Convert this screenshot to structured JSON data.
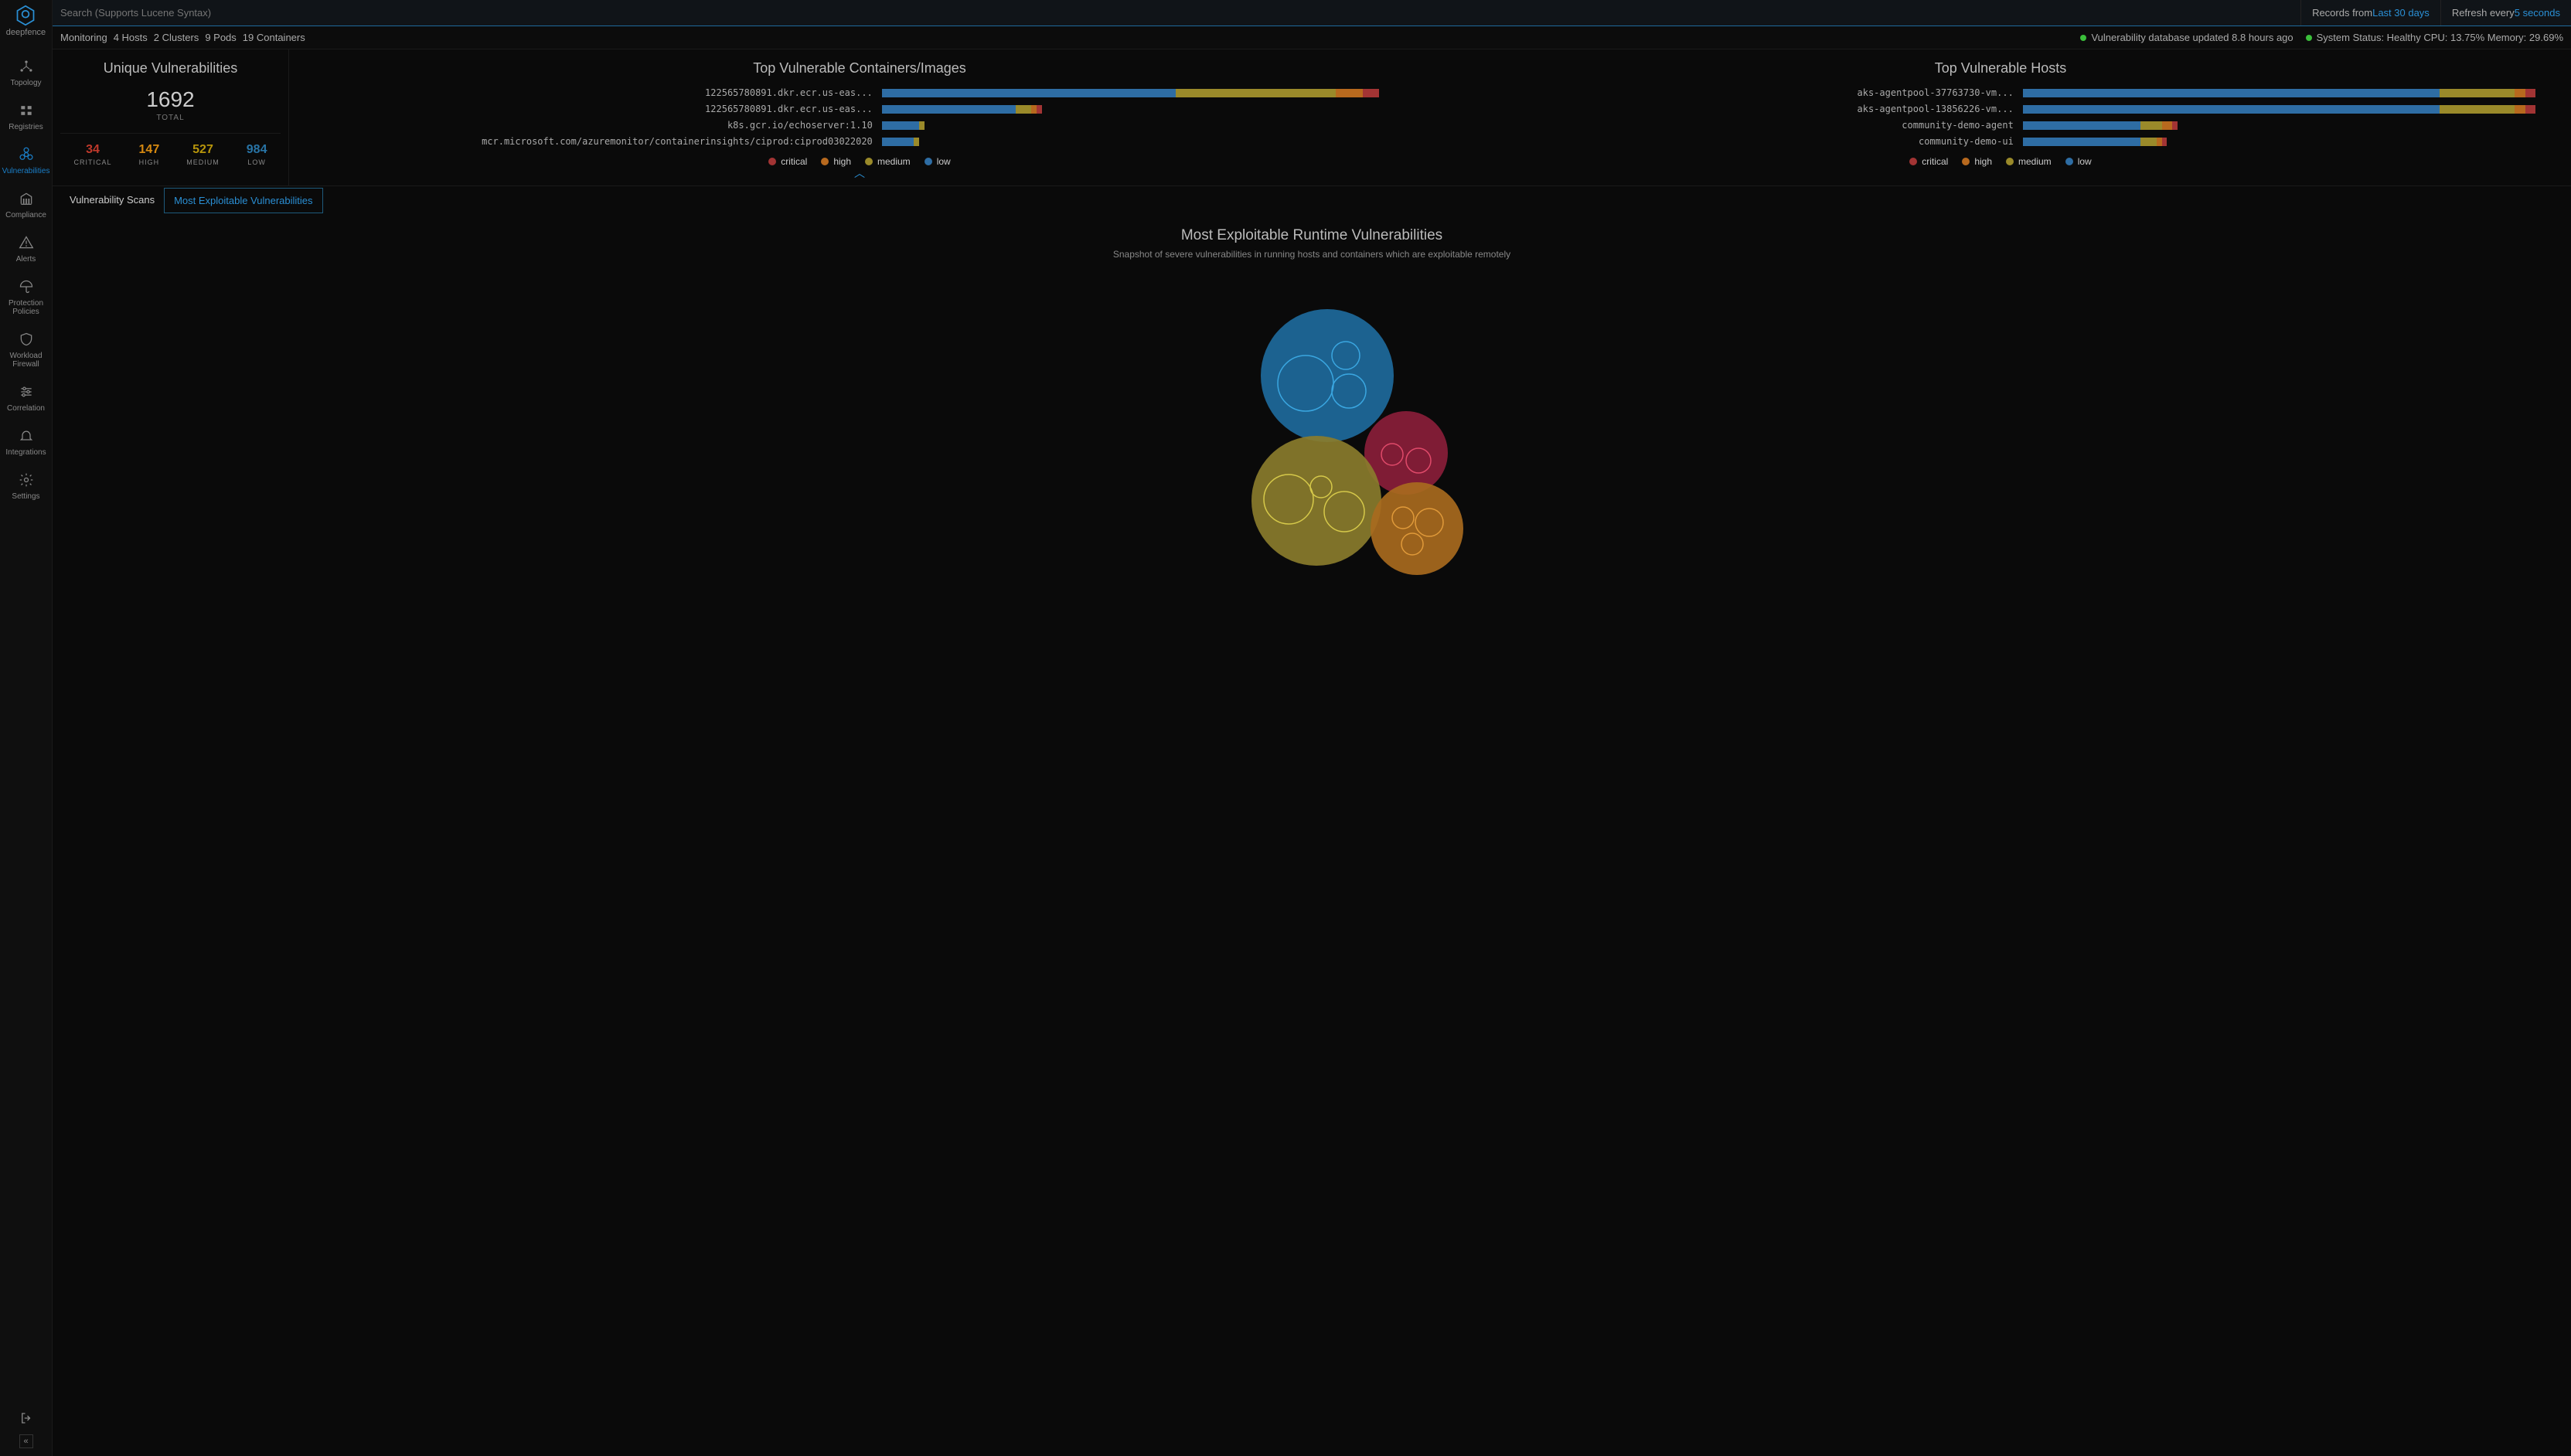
{
  "brand": "deepfence",
  "search": {
    "placeholder": "Search (Supports Lucene Syntax)"
  },
  "topbar": {
    "records_label": "Records from ",
    "records_value": "Last 30 days",
    "refresh_label": "Refresh every ",
    "refresh_value": "5 seconds"
  },
  "statusbar": {
    "monitoring": "Monitoring",
    "hosts": "4 Hosts",
    "clusters": "2 Clusters",
    "pods": "9 Pods",
    "containers": "19 Containers",
    "vuln_db": "Vulnerability database updated 8.8 hours ago",
    "system_status": "System Status: Healthy CPU: 13.75% Memory: 29.69%"
  },
  "sidebar": {
    "items": [
      {
        "label": "Topology"
      },
      {
        "label": "Registries"
      },
      {
        "label": "Vulnerabilities"
      },
      {
        "label": "Compliance"
      },
      {
        "label": "Alerts"
      },
      {
        "label": "Protection Policies"
      },
      {
        "label": "Workload Firewall"
      },
      {
        "label": "Correlation"
      },
      {
        "label": "Integrations"
      },
      {
        "label": "Settings"
      }
    ]
  },
  "unique": {
    "title": "Unique Vulnerabilities",
    "total": "1692",
    "total_label": "TOTAL",
    "severities": [
      {
        "value": "34",
        "label": "CRITICAL",
        "class": "critical"
      },
      {
        "value": "147",
        "label": "HIGH",
        "class": "high"
      },
      {
        "value": "527",
        "label": "MEDIUM",
        "class": "medium"
      },
      {
        "value": "984",
        "label": "LOW",
        "class": "low"
      }
    ]
  },
  "legend": {
    "critical": "critical",
    "high": "high",
    "medium": "medium",
    "low": "low"
  },
  "tabs": {
    "scans": "Vulnerability Scans",
    "exploit": "Most Exploitable Vulnerabilities"
  },
  "section": {
    "title": "Most Exploitable Runtime Vulnerabilities",
    "subtitle": "Snapshot of severe vulnerabilities in running hosts and containers which are exploitable remotely"
  },
  "chart_data": [
    {
      "type": "bar",
      "title": "Top Vulnerable Containers/Images",
      "orientation": "horizontal",
      "stacked": true,
      "xlabel": "",
      "ylabel": "",
      "categories": [
        "122565780891.dkr.ecr.us-eas...",
        "122565780891.dkr.ecr.us-eas...",
        "k8s.gcr.io/echoserver:1.10",
        "mcr.microsoft.com/azuremonitor/containerinsights/ciprod:ciprod03022020"
      ],
      "series": [
        {
          "name": "low",
          "values": [
            55,
            25,
            7,
            6
          ]
        },
        {
          "name": "medium",
          "values": [
            30,
            3,
            1,
            1
          ]
        },
        {
          "name": "high",
          "values": [
            5,
            1,
            0,
            0
          ]
        },
        {
          "name": "critical",
          "values": [
            3,
            1,
            0,
            0
          ]
        }
      ],
      "xlim": [
        0,
        100
      ]
    },
    {
      "type": "bar",
      "title": "Top Vulnerable Hosts",
      "orientation": "horizontal",
      "stacked": true,
      "xlabel": "",
      "ylabel": "",
      "categories": [
        "aks-agentpool-37763730-vm...",
        "aks-agentpool-13856226-vm...",
        "community-demo-agent",
        "community-demo-ui"
      ],
      "series": [
        {
          "name": "low",
          "values": [
            78,
            78,
            22,
            22
          ]
        },
        {
          "name": "medium",
          "values": [
            14,
            14,
            4,
            3
          ]
        },
        {
          "name": "high",
          "values": [
            2,
            2,
            2,
            1
          ]
        },
        {
          "name": "critical",
          "values": [
            2,
            2,
            1,
            1
          ]
        }
      ],
      "xlim": [
        0,
        100
      ]
    }
  ],
  "bubbles": {
    "colors": {
      "low": "#1e6a9c",
      "medium": "#8a7c2c",
      "high": "#a86a1e",
      "critical": "#8a1e3a"
    },
    "groups": [
      {
        "severity": "low",
        "cx": 260,
        "cy": 120,
        "r": 86,
        "inner": [
          {
            "cx": 232,
            "cy": 130,
            "r": 36
          },
          {
            "cx": 284,
            "cy": 94,
            "r": 18
          },
          {
            "cx": 288,
            "cy": 140,
            "r": 22
          }
        ]
      },
      {
        "severity": "critical",
        "cx": 362,
        "cy": 220,
        "r": 54,
        "inner": [
          {
            "cx": 344,
            "cy": 222,
            "r": 14
          },
          {
            "cx": 378,
            "cy": 230,
            "r": 16
          }
        ]
      },
      {
        "severity": "medium",
        "cx": 246,
        "cy": 282,
        "r": 84,
        "inner": [
          {
            "cx": 210,
            "cy": 280,
            "r": 32
          },
          {
            "cx": 252,
            "cy": 264,
            "r": 14
          },
          {
            "cx": 282,
            "cy": 296,
            "r": 26
          }
        ]
      },
      {
        "severity": "high",
        "cx": 376,
        "cy": 318,
        "r": 60,
        "inner": [
          {
            "cx": 358,
            "cy": 304,
            "r": 14
          },
          {
            "cx": 392,
            "cy": 310,
            "r": 18
          },
          {
            "cx": 370,
            "cy": 338,
            "r": 14
          }
        ]
      }
    ]
  }
}
